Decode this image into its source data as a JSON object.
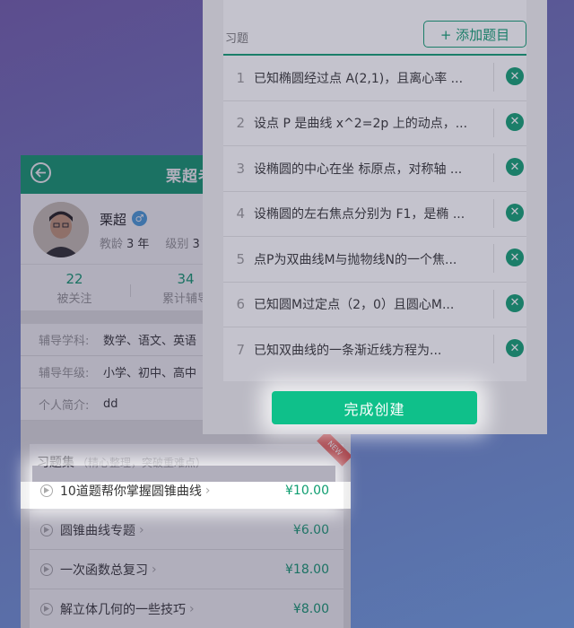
{
  "profile_screen": {
    "title": "栗超老",
    "teacher": {
      "name": "栗超",
      "gender_icon": "male-icon",
      "teaching_years_label": "教龄",
      "teaching_years_value": "3 年",
      "level_label": "级别",
      "level_value": "3"
    },
    "stats": [
      {
        "value": "22",
        "label": "被关注"
      },
      {
        "value": "34",
        "label": "累计辅导"
      }
    ],
    "info": [
      {
        "key": "辅导学科:",
        "value": "数学、语文、英语"
      },
      {
        "key": "辅导年级:",
        "value": "小学、初中、高中"
      },
      {
        "key": "个人简介:",
        "value": "dd"
      }
    ],
    "exercise_sets": {
      "title": "习题集",
      "note": "（精心整理，突破重难点）",
      "badge": "NEW",
      "items": [
        {
          "title": "10道题帮你掌握圆锥曲线",
          "price": "¥10.00"
        },
        {
          "title": "圆锥曲线专题",
          "price": "¥6.00"
        },
        {
          "title": "一次函数总复习",
          "price": "¥18.00"
        },
        {
          "title": "解立体几何的一些技巧",
          "price": "¥8.00"
        }
      ]
    }
  },
  "question_screen": {
    "section_label": "习题",
    "add_button": "+ 添加题目",
    "questions": [
      {
        "num": "1",
        "text": "已知椭圆经过点 A(2,1)，且离心率 ..."
      },
      {
        "num": "2",
        "text": "设点 P 是曲线 x^2=2p 上的动点，..."
      },
      {
        "num": "3",
        "text": "设椭圆的中心在坐 标原点，对称轴 ..."
      },
      {
        "num": "4",
        "text": "设椭圆的左右焦点分别为 F1，是椭 ..."
      },
      {
        "num": "5",
        "text": "点P为双曲线M与抛物线N的一个焦..."
      },
      {
        "num": "6",
        "text": " 已知圆M过定点（2，0）且圆心M..."
      },
      {
        "num": "7",
        "text": " 已知双曲线的一条渐近线方程为..."
      }
    ],
    "finish_button": "完成创建"
  },
  "colors": {
    "accent": "#0e9d70",
    "button": "#0fc08a",
    "badge": "#e8453c"
  }
}
